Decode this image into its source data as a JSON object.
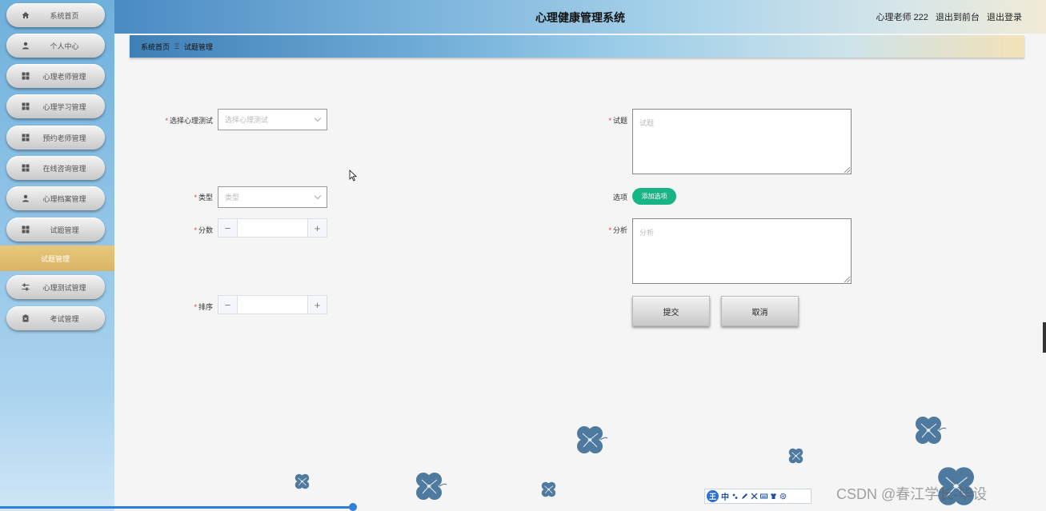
{
  "app": {
    "title": "心理健康管理系统"
  },
  "header": {
    "user": "心理老师 222",
    "goto_front": "退出到前台",
    "logout": "退出登录"
  },
  "breadcrumb": {
    "home": "系统首页",
    "separator": "Ξ",
    "current": "试题管理"
  },
  "sidebar": {
    "items": [
      {
        "label": "系统首页",
        "icon": "home-icon"
      },
      {
        "label": "个人中心",
        "icon": "user-icon"
      },
      {
        "label": "心理老师管理",
        "icon": "grid-icon"
      },
      {
        "label": "心理学习管理",
        "icon": "grid-icon"
      },
      {
        "label": "预约老师管理",
        "icon": "grid-icon"
      },
      {
        "label": "在线咨询管理",
        "icon": "grid-icon"
      },
      {
        "label": "心理档案管理",
        "icon": "user-icon"
      },
      {
        "label": "试题管理",
        "icon": "grid-icon"
      },
      {
        "label": "心理测试管理",
        "icon": "sliders-icon"
      },
      {
        "label": "考试管理",
        "icon": "clipboard-icon"
      }
    ],
    "submenu_active": "试题管理"
  },
  "form": {
    "test": {
      "label": "选择心理测试",
      "placeholder": "选择心理测试",
      "required": "*"
    },
    "type": {
      "label": "类型",
      "placeholder": "类型",
      "required": "*"
    },
    "score": {
      "label": "分数",
      "required": "*",
      "minus": "−",
      "plus": "+"
    },
    "order": {
      "label": "排序",
      "required": "*",
      "minus": "−",
      "plus": "+"
    },
    "question": {
      "label": "试题",
      "placeholder": "试题",
      "required": "*"
    },
    "options": {
      "label": "选项",
      "add_button": "添加选项"
    },
    "analysis": {
      "label": "分析",
      "placeholder": "分析",
      "required": "*"
    },
    "submit": "提交",
    "cancel": "取消"
  },
  "watermark": "CSDN @春江学长-毕设",
  "ime": {
    "logo": "王",
    "mode": "中"
  },
  "colors": {
    "accent_green": "#17b486",
    "required_red": "#e23b3b",
    "flower": "#4f7a9f"
  }
}
